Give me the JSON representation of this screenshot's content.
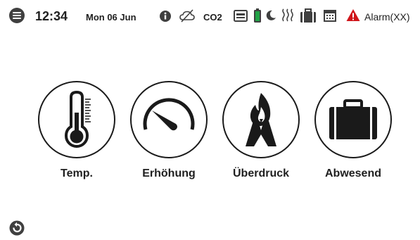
{
  "status_bar": {
    "time": "12:34",
    "date": "Mon 06 Jun",
    "co2_label": "CO2",
    "alarm_label": "Alarm(XX)",
    "icons": [
      "menu-icon",
      "info-icon",
      "no-cloud-icon",
      "co2-indicator",
      "display-icon",
      "battery-icon",
      "night-moon-icon",
      "heating-icon",
      "suitcase-icon",
      "calendar-icon",
      "warning-icon"
    ],
    "colors": {
      "battery": "#22a447",
      "warning": "#d0161b",
      "icon": "#404040"
    }
  },
  "tiles": [
    {
      "id": "temp",
      "label": "Temp.",
      "icon": "thermometer-icon"
    },
    {
      "id": "boost",
      "label": "Erhöhung",
      "icon": "gauge-icon"
    },
    {
      "id": "overpressure",
      "label": "Überdruck",
      "icon": "fireplace-icon"
    },
    {
      "id": "away",
      "label": "Abwesend",
      "icon": "suitcase-icon"
    }
  ],
  "footer": {
    "back_icon": "back-arrow-icon"
  }
}
